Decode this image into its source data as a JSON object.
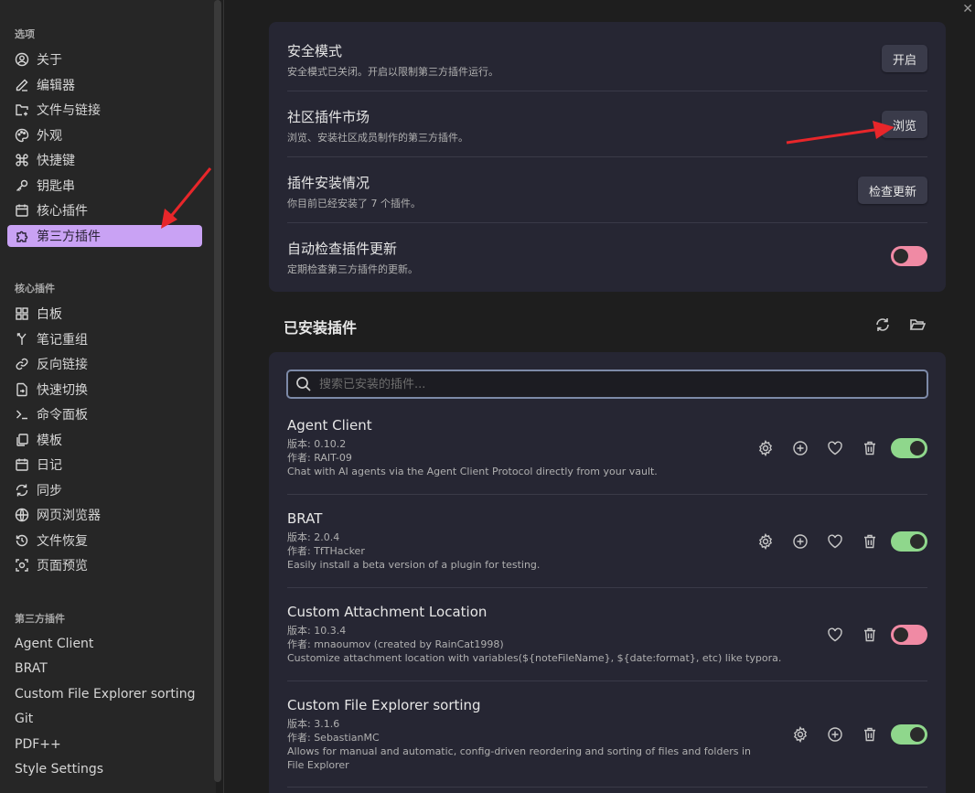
{
  "sidebar": {
    "options_title": "选项",
    "options": [
      {
        "label": "关于",
        "icon": "user-circle-icon"
      },
      {
        "label": "编辑器",
        "icon": "pencil-icon"
      },
      {
        "label": "文件与链接",
        "icon": "folder-link-icon"
      },
      {
        "label": "外观",
        "icon": "palette-icon"
      },
      {
        "label": "快捷键",
        "icon": "command-icon"
      },
      {
        "label": "钥匙串",
        "icon": "key-icon"
      },
      {
        "label": "核心插件",
        "icon": "calendar-icon"
      },
      {
        "label": "第三方插件",
        "icon": "puzzle-icon",
        "active": true
      }
    ],
    "core_title": "核心插件",
    "core": [
      {
        "label": "白板",
        "icon": "canvas-icon"
      },
      {
        "label": "笔记重组",
        "icon": "merge-icon"
      },
      {
        "label": "反向链接",
        "icon": "link-icon"
      },
      {
        "label": "快速切换",
        "icon": "file-switch-icon"
      },
      {
        "label": "命令面板",
        "icon": "terminal-icon"
      },
      {
        "label": "模板",
        "icon": "template-icon"
      },
      {
        "label": "日记",
        "icon": "calendar-day-icon"
      },
      {
        "label": "同步",
        "icon": "sync-icon"
      },
      {
        "label": "网页浏览器",
        "icon": "globe-icon"
      },
      {
        "label": "文件恢复",
        "icon": "history-icon"
      },
      {
        "label": "页面预览",
        "icon": "preview-icon"
      }
    ],
    "third_title": "第三方插件",
    "third": [
      "Agent Client",
      "BRAT",
      "Custom File Explorer sorting",
      "Git",
      "PDF++",
      "Style Settings"
    ]
  },
  "settings": {
    "safe_mode": {
      "title": "安全模式",
      "desc": "安全模式已关闭。开启以限制第三方插件运行。",
      "button": "开启"
    },
    "community": {
      "title": "社区插件市场",
      "desc": "浏览、安装社区成员制作的第三方插件。",
      "button": "浏览"
    },
    "install_status": {
      "title": "插件安装情况",
      "desc": "你目前已经安装了 7 个插件。",
      "button": "检查更新"
    },
    "auto_check": {
      "title": "自动检查插件更新",
      "desc": "定期检查第三方插件的更新。",
      "enabled": false
    }
  },
  "installed": {
    "heading": "已安装插件",
    "search_placeholder": "搜索已安装的插件...",
    "plugins": [
      {
        "name": "Agent Client",
        "version": "版本: 0.10.2",
        "author": "作者:  RAIT-09",
        "desc": "Chat with AI agents via the Agent Client Protocol directly from your vault.",
        "enabled": true
      },
      {
        "name": "BRAT",
        "version": "版本: 2.0.4",
        "author": "作者:  TfTHacker",
        "desc": "Easily install a beta version of a plugin for testing.",
        "enabled": true
      },
      {
        "name": "Custom Attachment Location",
        "version": "版本: 10.3.4",
        "author": "作者:  mnaoumov (created by RainCat1998)",
        "desc": "Customize attachment location with variables(${noteFileName}, ${date:format}, etc) like typora.",
        "enabled": false
      },
      {
        "name": "Custom File Explorer sorting",
        "version": "版本: 3.1.6",
        "author": "作者:  SebastianMC",
        "desc": "Allows for manual and automatic, config-driven reordering and sorting of files and folders in File Explorer",
        "enabled": true
      }
    ]
  },
  "colors": {
    "accent": "#c9a2f4",
    "toggle_on": "#8fd78c",
    "toggle_off": "#f08aa4",
    "arrow": "#e8262a"
  }
}
